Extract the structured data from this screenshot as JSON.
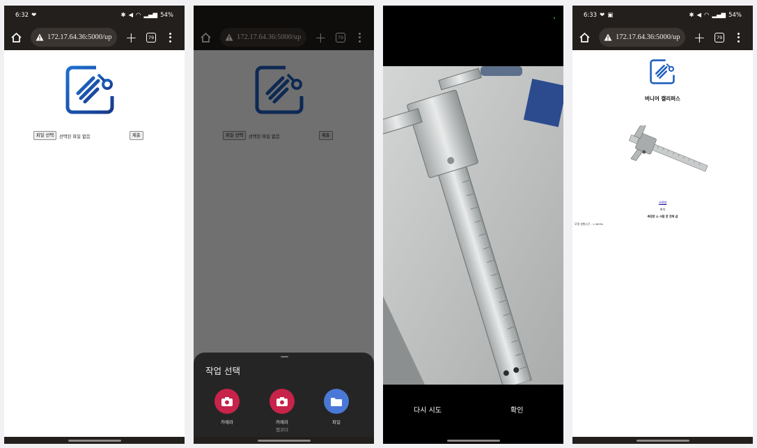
{
  "browser": {
    "url": "172.17.64.36:5000/up",
    "tab_count": "79"
  },
  "screen1": {
    "time": "6:32",
    "battery": "54%"
  },
  "screen4": {
    "time": "6:33",
    "battery": "54%"
  },
  "upload_form": {
    "choose_file_label": "파일 선택",
    "no_file_text": "선택된 파일 없음",
    "submit_label": "제출"
  },
  "chooser": {
    "title": "작업 선택",
    "actions": [
      {
        "label": "카메라",
        "sublabel": "",
        "icon": "camera-icon",
        "color": "#c8234a"
      },
      {
        "label": "카메라",
        "sublabel": "캠코더",
        "icon": "camcorder-icon",
        "color": "#c8234a"
      },
      {
        "label": "파일",
        "sublabel": "",
        "icon": "folder-icon",
        "color": "#4a78d6"
      }
    ]
  },
  "camera": {
    "retry_label": "다시 시도",
    "confirm_label": "확인"
  },
  "result": {
    "title": "버니어 캘리퍼스",
    "usage_link": "사용법",
    "position_text": "위치",
    "result_text": "측정한 소 사람 한 전체 값",
    "inference_time": "모델 실행시간 : 1.4809s"
  },
  "colors": {
    "browser_bar": "#231f1c",
    "logo_blue": "#1f5fbf"
  }
}
